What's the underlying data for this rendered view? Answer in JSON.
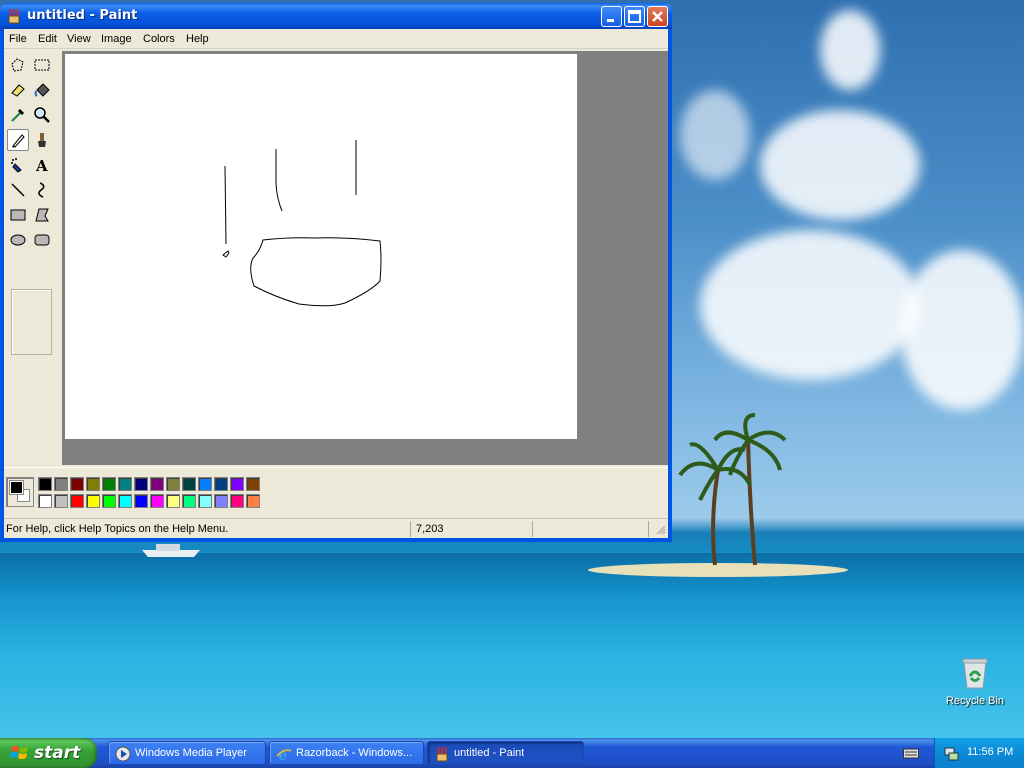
{
  "window": {
    "title": "untitled - Paint",
    "menus": [
      "File",
      "Edit",
      "View",
      "Image",
      "Colors",
      "Help"
    ]
  },
  "tools": [
    "free-form-select",
    "select",
    "eraser",
    "fill-with-color",
    "pick-color",
    "magnifier",
    "pencil",
    "brush",
    "airbrush",
    "text",
    "line",
    "curve",
    "rectangle",
    "polygon",
    "ellipse",
    "rounded-rectangle"
  ],
  "selected_tool": "pencil",
  "colors": {
    "foreground": "#000000",
    "background": "#ffffff",
    "palette_row1": [
      "#000000",
      "#808080",
      "#800000",
      "#808000",
      "#008000",
      "#008080",
      "#000080",
      "#800080",
      "#808040",
      "#004040",
      "#0080ff",
      "#004080",
      "#8000ff",
      "#804000"
    ],
    "palette_row2": [
      "#ffffff",
      "#c0c0c0",
      "#ff0000",
      "#ffff00",
      "#00ff00",
      "#00ffff",
      "#0000ff",
      "#ff00ff",
      "#ffff80",
      "#00ff80",
      "#80ffff",
      "#8080ff",
      "#ff0080",
      "#ff8040"
    ]
  },
  "status": {
    "help_text": "For Help, click Help Topics on the Help Menu.",
    "coords": "7,203"
  },
  "desktop": {
    "recycle_bin_label": "Recycle Bin"
  },
  "taskbar": {
    "start_label": "start",
    "tasks": [
      {
        "label": "Windows Media Player",
        "icon": "media-player-icon",
        "active": false
      },
      {
        "label": "Razorback - Windows...",
        "icon": "internet-explorer-icon",
        "active": false
      },
      {
        "label": "untitled - Paint",
        "icon": "paint-icon",
        "active": true
      }
    ],
    "clock": "11:56 PM"
  }
}
